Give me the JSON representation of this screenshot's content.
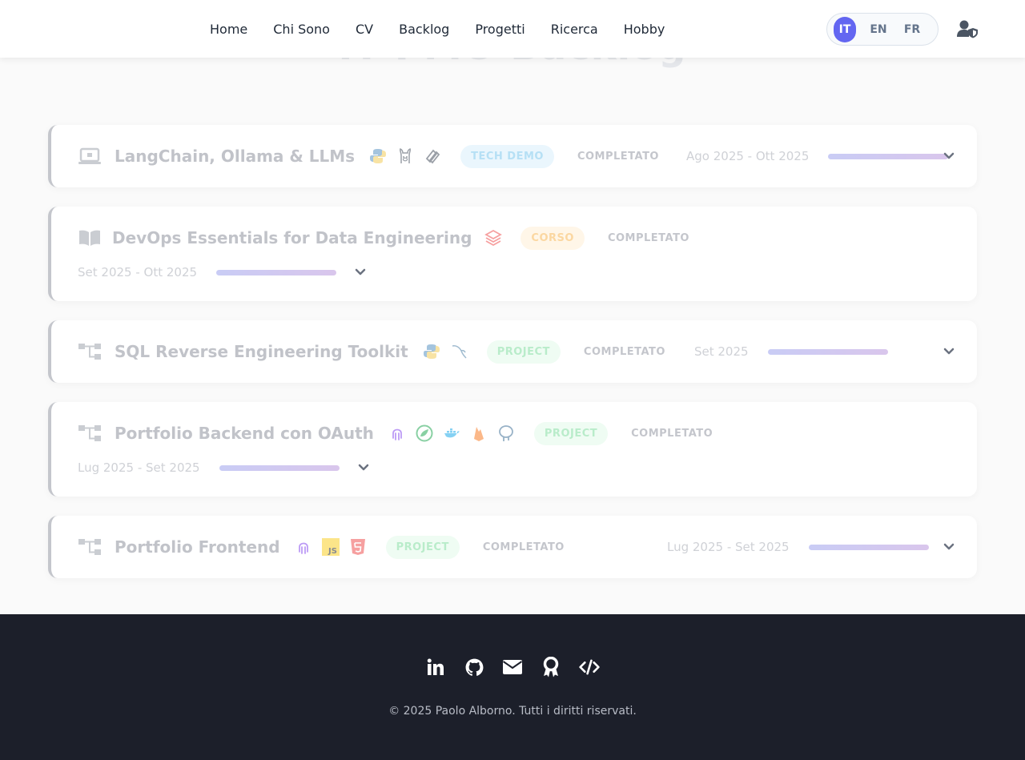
{
  "hero": {
    "title": "IT PMO Backlog"
  },
  "nav": {
    "links": [
      "Home",
      "Chi Sono",
      "CV",
      "Backlog",
      "Progetti",
      "Ricerca",
      "Hobby"
    ],
    "languages": [
      "IT",
      "EN",
      "FR"
    ],
    "active_language": "IT",
    "admin_icon": "user-shield-icon"
  },
  "items": [
    {
      "title": "LangChain, Ollama & LLMs",
      "icon": "laptop-code-icon",
      "techs": [
        "python-icon",
        "ollama-icon",
        "langchain-icon"
      ],
      "badge": "TECH DEMO",
      "status": "COMPLETATO",
      "date": "Ago 2025 - Ott 2025",
      "progress": 1.0
    },
    {
      "title": "DevOps Essentials for Data Engineering",
      "icon": "book-open-icon",
      "techs": [
        "databricks-icon"
      ],
      "badge": "CORSO",
      "status": "COMPLETATO",
      "date": "Set 2025 - Ott 2025",
      "progress": 1.0
    },
    {
      "title": "SQL Reverse Engineering Toolkit",
      "icon": "sitemap-icon",
      "techs": [
        "python-icon",
        "mysql-icon"
      ],
      "badge": "PROJECT",
      "status": "COMPLETATO",
      "date": "Set 2025",
      "progress": 1.0
    },
    {
      "title": "Portfolio Backend con OAuth",
      "icon": "sitemap-icon",
      "techs": [
        "octopus-icon",
        "spring-icon",
        "docker-icon",
        "firebase-icon",
        "postgresql-icon"
      ],
      "badge": "PROJECT",
      "status": "COMPLETATO",
      "date": "Lug 2025 - Set 2025",
      "progress": 1.0
    },
    {
      "title": "Portfolio Frontend",
      "icon": "sitemap-icon",
      "techs": [
        "octopus-icon",
        "javascript-icon",
        "html5-icon"
      ],
      "badge": "PROJECT",
      "status": "COMPLETATO",
      "date": "Lug 2025 - Set 2025",
      "progress": 1.0
    }
  ],
  "footer": {
    "social": [
      "linkedin-icon",
      "github-icon",
      "envelope-icon",
      "award-icon",
      "code-icon"
    ],
    "copyright": "© 2025 Paolo Alborno. Tutti i diritti riservati."
  },
  "colors": {
    "accent": "#6366f1",
    "footer_bg": "#1c1f2a"
  }
}
